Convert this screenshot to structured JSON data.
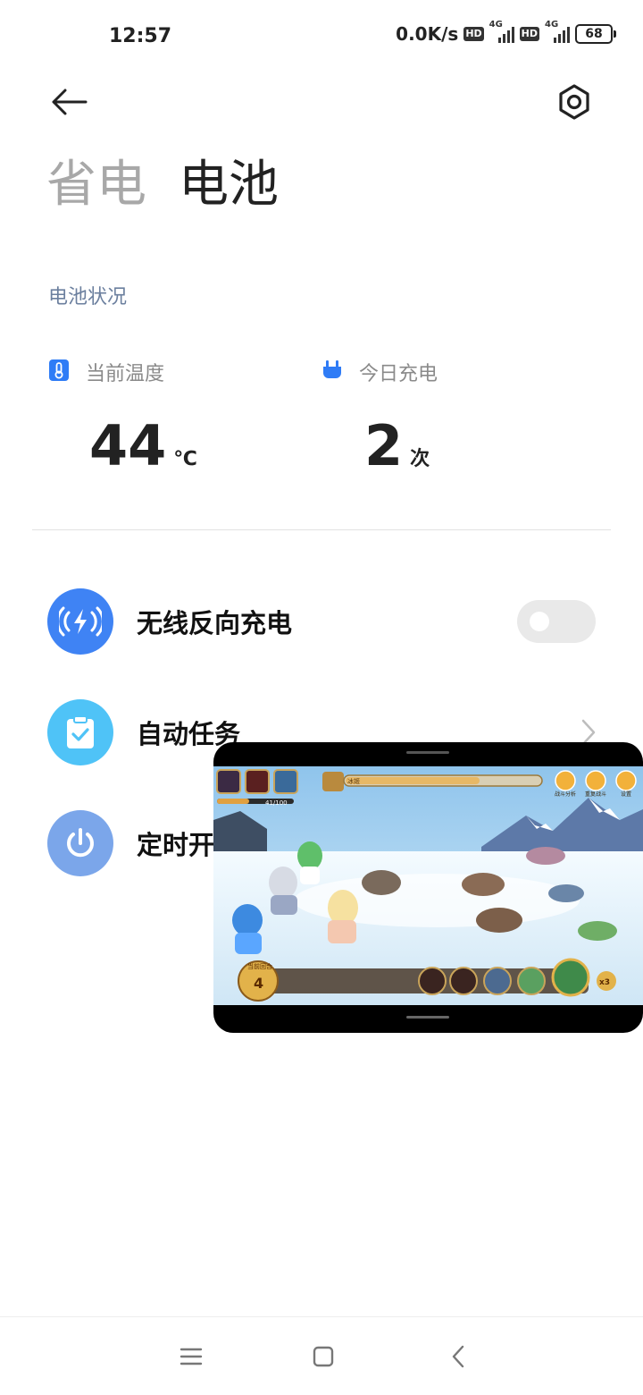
{
  "status_bar": {
    "time": "12:57",
    "network_speed": "0.0K/s",
    "sim1": {
      "hd": "HD",
      "tech": "4G"
    },
    "sim2": {
      "hd": "HD",
      "tech": "4G"
    },
    "battery_level": "68"
  },
  "header": {
    "back_icon": "arrow-left",
    "settings_icon": "gear-hexagon",
    "tabs": [
      {
        "label": "省电",
        "active": false
      },
      {
        "label": "电池",
        "active": true
      }
    ]
  },
  "battery_status": {
    "section_label": "电池状况",
    "temperature": {
      "label": "当前温度",
      "value": "44",
      "unit": "℃",
      "icon": "thermometer"
    },
    "charges_today": {
      "label": "今日充电",
      "value": "2",
      "unit": "次",
      "icon": "plug"
    }
  },
  "settings_rows": [
    {
      "label": "无线反向充电",
      "icon": "wireless-charge",
      "icon_color": "#3f83f4",
      "control": "toggle",
      "toggle_on": false
    },
    {
      "label": "自动任务",
      "icon": "clipboard-check",
      "icon_color": "#4fc3f7",
      "control": "chevron"
    },
    {
      "label": "定时开",
      "icon": "power",
      "icon_color": "#7ba6ea",
      "control": "none"
    }
  ],
  "floating_window": {
    "app": "game",
    "hud": {
      "boss_name": "冰姬",
      "score": "41/100",
      "stage": "4",
      "stage_caption": "当前回合",
      "speed": "x3",
      "top_button_labels": [
        "战斗分析",
        "重复战斗",
        "设置"
      ]
    }
  },
  "nav_bar": {
    "buttons": [
      "menu",
      "home",
      "back"
    ]
  },
  "colors": {
    "accent_blue": "#3f83f4",
    "section_label": "#6b7f9e",
    "inactive_tab": "#a8a8a8"
  }
}
